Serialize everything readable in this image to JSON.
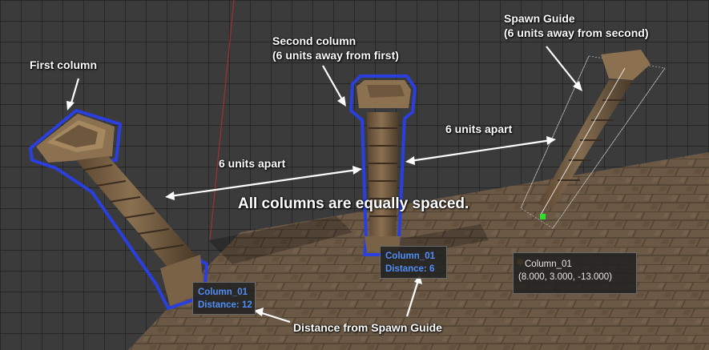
{
  "annotations": {
    "first_column": "First column",
    "second_column_line1": "Second column",
    "second_column_line2": "(6 units away from first)",
    "spawn_guide_line1": "Spawn Guide",
    "spawn_guide_line2": "(6 units away from second)",
    "apart_left": "6 units apart",
    "apart_right": "6 units apart",
    "equally_spaced": "All columns are equally spaced.",
    "distance_from_guide": "Distance from Spawn Guide"
  },
  "tooltips": {
    "column_1": {
      "name": "Column_01",
      "distance": "Distance: 12"
    },
    "column_2": {
      "name": "Column_01",
      "distance": "Distance: 6"
    },
    "spawn_guide": {
      "name": "Column_01",
      "position": "(8.000, 3.000, -13.000)"
    }
  },
  "colors": {
    "selection_outline": "#2a3fe0",
    "tooltip_text_blue": "#4f8ef7",
    "grid_background": "#3a3a3a",
    "pivot_handle": "#f0a020",
    "guide_handle": "#2ee02e"
  },
  "icons": {
    "pivot": "orange-pivot-dot-icon",
    "handle": "green-square-handle-icon"
  }
}
